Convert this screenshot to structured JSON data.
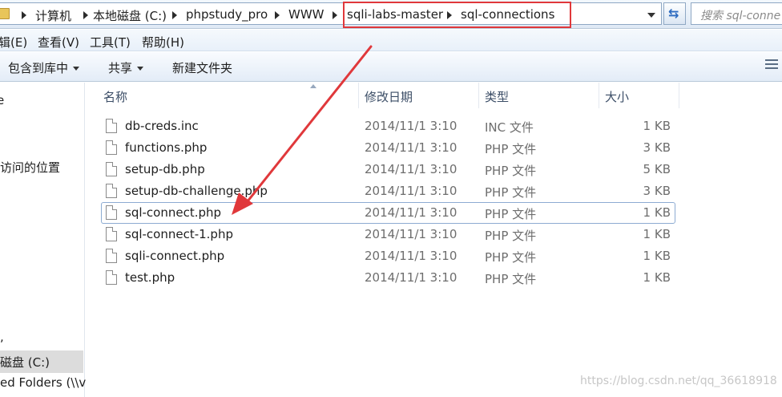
{
  "address_bar": {
    "crumbs": [
      "计算机",
      "本地磁盘 (C:)",
      "phpstudy_pro",
      "WWW",
      "sqli-labs-master",
      "sql-connections"
    ],
    "search_placeholder": "搜索 sql-conne"
  },
  "menu": [
    "辑(E)",
    "查看(V)",
    "工具(T)",
    "帮助(H)"
  ],
  "toolbar": {
    "include_library": "包含到库中",
    "share": "共享",
    "new_folder": "新建文件夹"
  },
  "nav": {
    "item_top": "e",
    "recent_places": "访问的位置",
    "item_comma": ",",
    "local_disk": "磁盘 (C:)",
    "shared_folders": "ed Folders (\\\\v"
  },
  "columns": {
    "name": "名称",
    "date": "修改日期",
    "type": "类型",
    "size": "大小"
  },
  "files": [
    {
      "name": "db-creds.inc",
      "date": "2014/11/1 3:10",
      "type": "INC 文件",
      "size": "1 KB"
    },
    {
      "name": "functions.php",
      "date": "2014/11/1 3:10",
      "type": "PHP 文件",
      "size": "3 KB"
    },
    {
      "name": "setup-db.php",
      "date": "2014/11/1 3:10",
      "type": "PHP 文件",
      "size": "5 KB"
    },
    {
      "name": "setup-db-challenge.php",
      "date": "2014/11/1 3:10",
      "type": "PHP 文件",
      "size": "3 KB"
    },
    {
      "name": "sql-connect.php",
      "date": "2014/11/1 3:10",
      "type": "PHP 文件",
      "size": "1 KB"
    },
    {
      "name": "sql-connect-1.php",
      "date": "2014/11/1 3:10",
      "type": "PHP 文件",
      "size": "1 KB"
    },
    {
      "name": "sqli-connect.php",
      "date": "2014/11/1 3:10",
      "type": "PHP 文件",
      "size": "1 KB"
    },
    {
      "name": "test.php",
      "date": "2014/11/1 3:10",
      "type": "PHP 文件",
      "size": "1 KB"
    }
  ],
  "watermark": "https://blog.csdn.net/qq_36618918",
  "colors": {
    "annotation_red": "#e0383b"
  }
}
